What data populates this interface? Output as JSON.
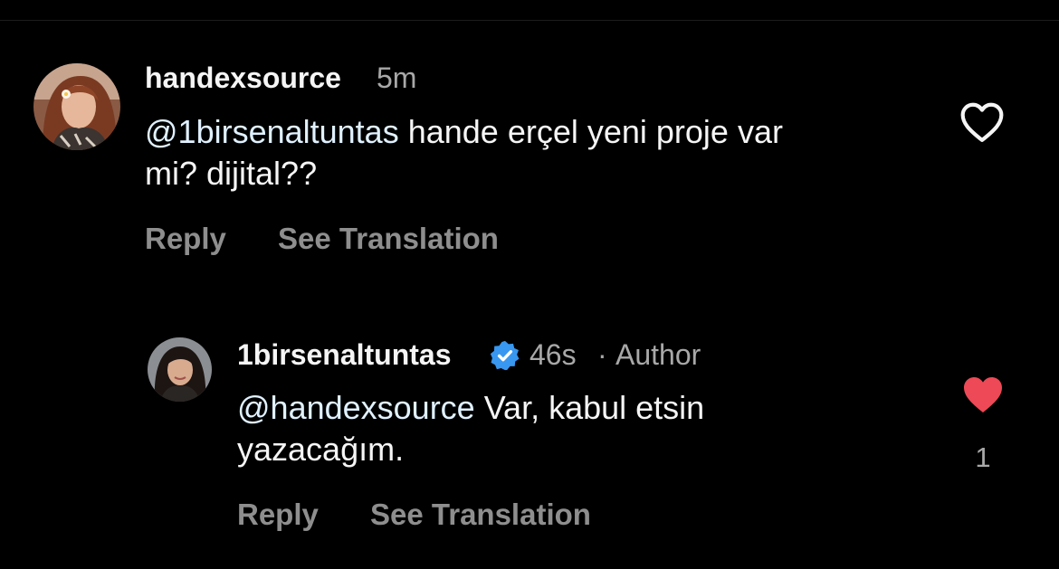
{
  "comment": {
    "username": "handexsource",
    "time": "5m",
    "mention": "@1birsenaltuntas",
    "text_line1": " hande erçel yeni proje var",
    "text_line2": "mi? dijital??",
    "reply_label": "Reply",
    "translate_label": "See Translation",
    "liked": false
  },
  "reply": {
    "username": "1birsenaltuntas",
    "verified": true,
    "time": "46s",
    "separator": "·",
    "author_badge": "Author",
    "mention": "@handexsource",
    "text_line1": " Var, kabul etsin",
    "text_line2": "yazacağım.",
    "reply_label": "Reply",
    "translate_label": "See Translation",
    "liked": true,
    "like_count": "1"
  },
  "colors": {
    "background": "#000000",
    "liked_heart": "#ed4956",
    "verified_badge": "#3897f0",
    "secondary_text": "#a8a8a8"
  },
  "icons": {
    "like_outline": "heart-outline-icon",
    "like_filled": "heart-filled-icon",
    "verified": "verified-badge-icon"
  }
}
